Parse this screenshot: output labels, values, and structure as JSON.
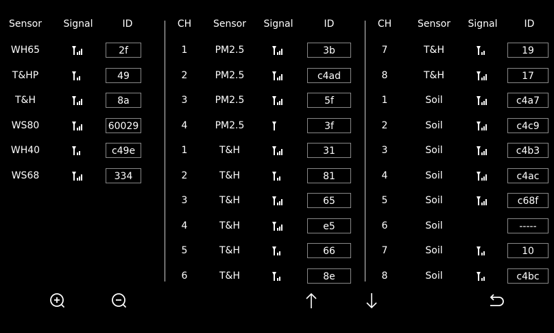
{
  "colors": {
    "background": "#000000",
    "text": "#ffffff",
    "box_border": "#8a8a8a",
    "divider": "#d0d0d0"
  },
  "panel1": {
    "headers": {
      "sensor": "Sensor",
      "signal": "Signal",
      "id": "ID"
    },
    "rows": [
      {
        "sensor": "WH65",
        "signal": 4,
        "id": "2f"
      },
      {
        "sensor": "T&HP",
        "signal": 3,
        "id": "49"
      },
      {
        "sensor": "T&H",
        "signal": 4,
        "id": "8a"
      },
      {
        "sensor": "WS80",
        "signal": 4,
        "id": "60029"
      },
      {
        "sensor": "WH40",
        "signal": 3,
        "id": "c49e"
      },
      {
        "sensor": "WS68",
        "signal": 4,
        "id": "334"
      }
    ]
  },
  "panel2": {
    "headers": {
      "ch": "CH",
      "sensor": "Sensor",
      "signal": "Signal",
      "id": "ID"
    },
    "rows": [
      {
        "ch": "1",
        "sensor": "PM2.5",
        "signal": 4,
        "id": "3b"
      },
      {
        "ch": "2",
        "sensor": "PM2.5",
        "signal": 4,
        "id": "c4ad"
      },
      {
        "ch": "3",
        "sensor": "PM2.5",
        "signal": 4,
        "id": "5f"
      },
      {
        "ch": "4",
        "sensor": "PM2.5",
        "signal": 1,
        "id": "3f"
      },
      {
        "ch": "1",
        "sensor": "T&H",
        "signal": 4,
        "id": "31"
      },
      {
        "ch": "2",
        "sensor": "T&H",
        "signal": 3,
        "id": "81"
      },
      {
        "ch": "3",
        "sensor": "T&H",
        "signal": 4,
        "id": "65"
      },
      {
        "ch": "4",
        "sensor": "T&H",
        "signal": 4,
        "id": "e5"
      },
      {
        "ch": "5",
        "sensor": "T&H",
        "signal": 3,
        "id": "66"
      },
      {
        "ch": "6",
        "sensor": "T&H",
        "signal": 3,
        "id": "8e"
      }
    ]
  },
  "panel3": {
    "headers": {
      "ch": "CH",
      "sensor": "Sensor",
      "signal": "Signal",
      "id": "ID"
    },
    "rows": [
      {
        "ch": "7",
        "sensor": "T&H",
        "signal": 3,
        "id": "19"
      },
      {
        "ch": "8",
        "sensor": "T&H",
        "signal": 4,
        "id": "17"
      },
      {
        "ch": "1",
        "sensor": "Soil",
        "signal": 4,
        "id": "c4a7"
      },
      {
        "ch": "2",
        "sensor": "Soil",
        "signal": 4,
        "id": "c4c9"
      },
      {
        "ch": "3",
        "sensor": "Soil",
        "signal": 4,
        "id": "c4b3"
      },
      {
        "ch": "4",
        "sensor": "Soil",
        "signal": 4,
        "id": "c4ac"
      },
      {
        "ch": "5",
        "sensor": "Soil",
        "signal": 4,
        "id": "c68f"
      },
      {
        "ch": "6",
        "sensor": "Soil",
        "signal": 0,
        "id": "-----"
      },
      {
        "ch": "7",
        "sensor": "Soil",
        "signal": 3,
        "id": "10"
      },
      {
        "ch": "8",
        "sensor": "Soil",
        "signal": 3,
        "id": "c4bc"
      }
    ]
  },
  "toolbar": [
    {
      "name": "zoom-in",
      "icon": "zoom-in-icon"
    },
    {
      "name": "zoom-out",
      "icon": "zoom-out-icon"
    },
    {
      "name": "scroll-up",
      "icon": "arrow-up-icon"
    },
    {
      "name": "scroll-down",
      "icon": "arrow-down-icon"
    },
    {
      "name": "back",
      "icon": "return-icon"
    }
  ]
}
